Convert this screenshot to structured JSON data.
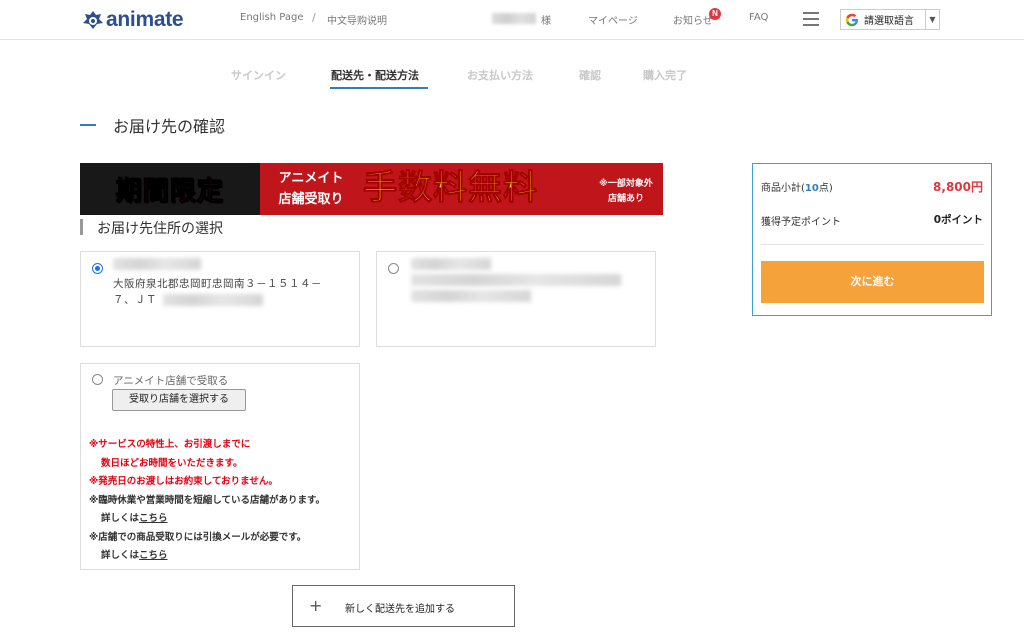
{
  "header": {
    "logo_text": "animate",
    "english_page": "English Page",
    "separator": "/",
    "chinese_guide": "中文导购说明",
    "user_suffix": "様",
    "mypage": "マイページ",
    "notice": "お知らせ",
    "notice_badge": "N",
    "faq": "FAQ",
    "translate_label": "請選取語言",
    "translate_arrow": "▼"
  },
  "steps": [
    {
      "label": "サインイン",
      "active": false
    },
    {
      "label": "配送先・配送方法",
      "active": true
    },
    {
      "label": "お支払い方法",
      "active": false
    },
    {
      "label": "確認",
      "active": false
    },
    {
      "label": "購入完了",
      "active": false
    }
  ],
  "page_title": "お届け先の確認",
  "banner": {
    "left": "期間限定",
    "mid_line1": "アニメイト",
    "mid_line2": "店舗受取り",
    "big": "手数料無料",
    "note_line1": "※一部対象外",
    "note_line2": "店舗あり"
  },
  "section_title": "お届け先住所の選択",
  "address_cards": {
    "card1_line1": "大阪府泉北郡忠岡町忠岡南３－１５１４－",
    "card1_line2": "７、ＪＴ",
    "card1_selected": true,
    "card2_selected": false
  },
  "store_pickup": {
    "label": "アニメイト店舗で受取る",
    "button": "受取り店舗を選択する",
    "note1_line1": "※サービスの特性上、お引渡しまでに",
    "note1_line2": "数日ほどお時間をいただきます。",
    "note2": "※発売日のお渡しはお約束しておりません。",
    "note3": "※臨時休業や営業時間を短縮している店舗があります。",
    "details_prefix": "詳しくは",
    "details_link": "こちら",
    "note4": "※店舗での商品受取りには引換メールが必要です。"
  },
  "add_address": {
    "plus": "+",
    "label": "新しく配送先を追加する"
  },
  "summary": {
    "subtotal_label_pre": "商品小計(",
    "subtotal_count": "10",
    "subtotal_label_post": "点)",
    "subtotal_price": "8,800円",
    "points_label": "獲得予定ポイント",
    "points_value": "0ポイント",
    "next_button": "次に進む"
  },
  "colors": {
    "brand": "#2d4f8f",
    "accent_blue": "#2d7fbf",
    "price_red": "#e0383e",
    "next_orange": "#f6a23a",
    "banner_red": "#c0161b",
    "banner_yellow": "#ffe600"
  }
}
